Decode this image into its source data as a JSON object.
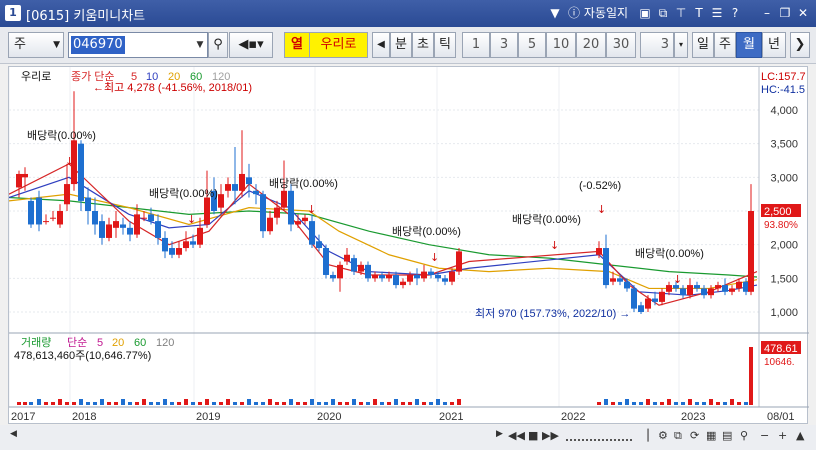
{
  "window": {
    "title": "[0615] 키움미니차트",
    "app_number": "1",
    "auto_update_label": "자동일지",
    "icons": [
      "down-arrow-icon",
      "info-icon",
      "window-icon",
      "copy-icon",
      "pin-icon",
      "text-icon",
      "list-icon",
      "help-icon",
      "minimize-icon",
      "restore-icon",
      "close-icon"
    ]
  },
  "toolbar": {
    "period_select": "주",
    "stock_code": "046970",
    "stock_name_prefix": "열",
    "stock_name": "우리로",
    "buttons": [
      "분",
      "초",
      "틱"
    ],
    "numbers": [
      "1",
      "3",
      "5",
      "10",
      "20",
      "30"
    ],
    "custom_number": "3",
    "periods": [
      "일",
      "주",
      "월",
      "년"
    ],
    "active_period": "월"
  },
  "chart": {
    "name_label": "우리로",
    "ma_legend_label": "종가 단순",
    "ma_periods": [
      "5",
      "10",
      "20",
      "60",
      "120"
    ],
    "ma_colors": {
      "5": "#d62728",
      "10": "#3040c0",
      "20": "#e0a000",
      "60": "#1a9a30",
      "120": "#a0a0a0"
    },
    "lc_label": "LC:157.7",
    "hc_label": "HC:-41.5",
    "last_price_tag": "2,500",
    "last_pct_tag": "93.80%",
    "max_annotation": "최고 4,278 (-41.56%, 2018/01)",
    "min_annotation": "최저 970 (157.73%, 2022/10)",
    "price_axis": [
      "4,000",
      "3,500",
      "3,000",
      "2,500",
      "2,000",
      "1,500",
      "1,000"
    ],
    "dividend_markers": [
      "배당락(0.00%)",
      "배당락(0.00%)",
      "배당락(0.00%)",
      "배당락(0.00%)",
      "배당락(0.00%)",
      "배당락(0.00%)"
    ],
    "adjust_marker": "(-0.52%)",
    "volume_label": "거래량",
    "volume_ma_label": "단순",
    "volume_ma_periods": [
      "5",
      "20",
      "60",
      "120"
    ],
    "volume_value": "478,613,460주(10,646.77%)",
    "volume_tag": "478.61",
    "volume_tag2": "10646.",
    "x_axis": [
      "2017",
      "2018",
      "2019",
      "2020",
      "2021",
      "2022",
      "2023",
      "08/01"
    ]
  },
  "chart_data": {
    "type": "candlestick",
    "y_axis": {
      "ticks": [
        1000,
        1500,
        2000,
        2500,
        3000,
        3500,
        4000
      ]
    },
    "max": {
      "value": 4278,
      "date": "2018/01"
    },
    "min": {
      "value": 970,
      "date": "2022/10"
    },
    "last_close": 2500
  },
  "statusbar": {
    "icons": [
      "play-icon",
      "rewind-icon",
      "stop-icon",
      "forward-icon",
      "zoom-slider",
      "magnify-icon",
      "settings-icon",
      "minus-icon",
      "plus-icon"
    ]
  }
}
